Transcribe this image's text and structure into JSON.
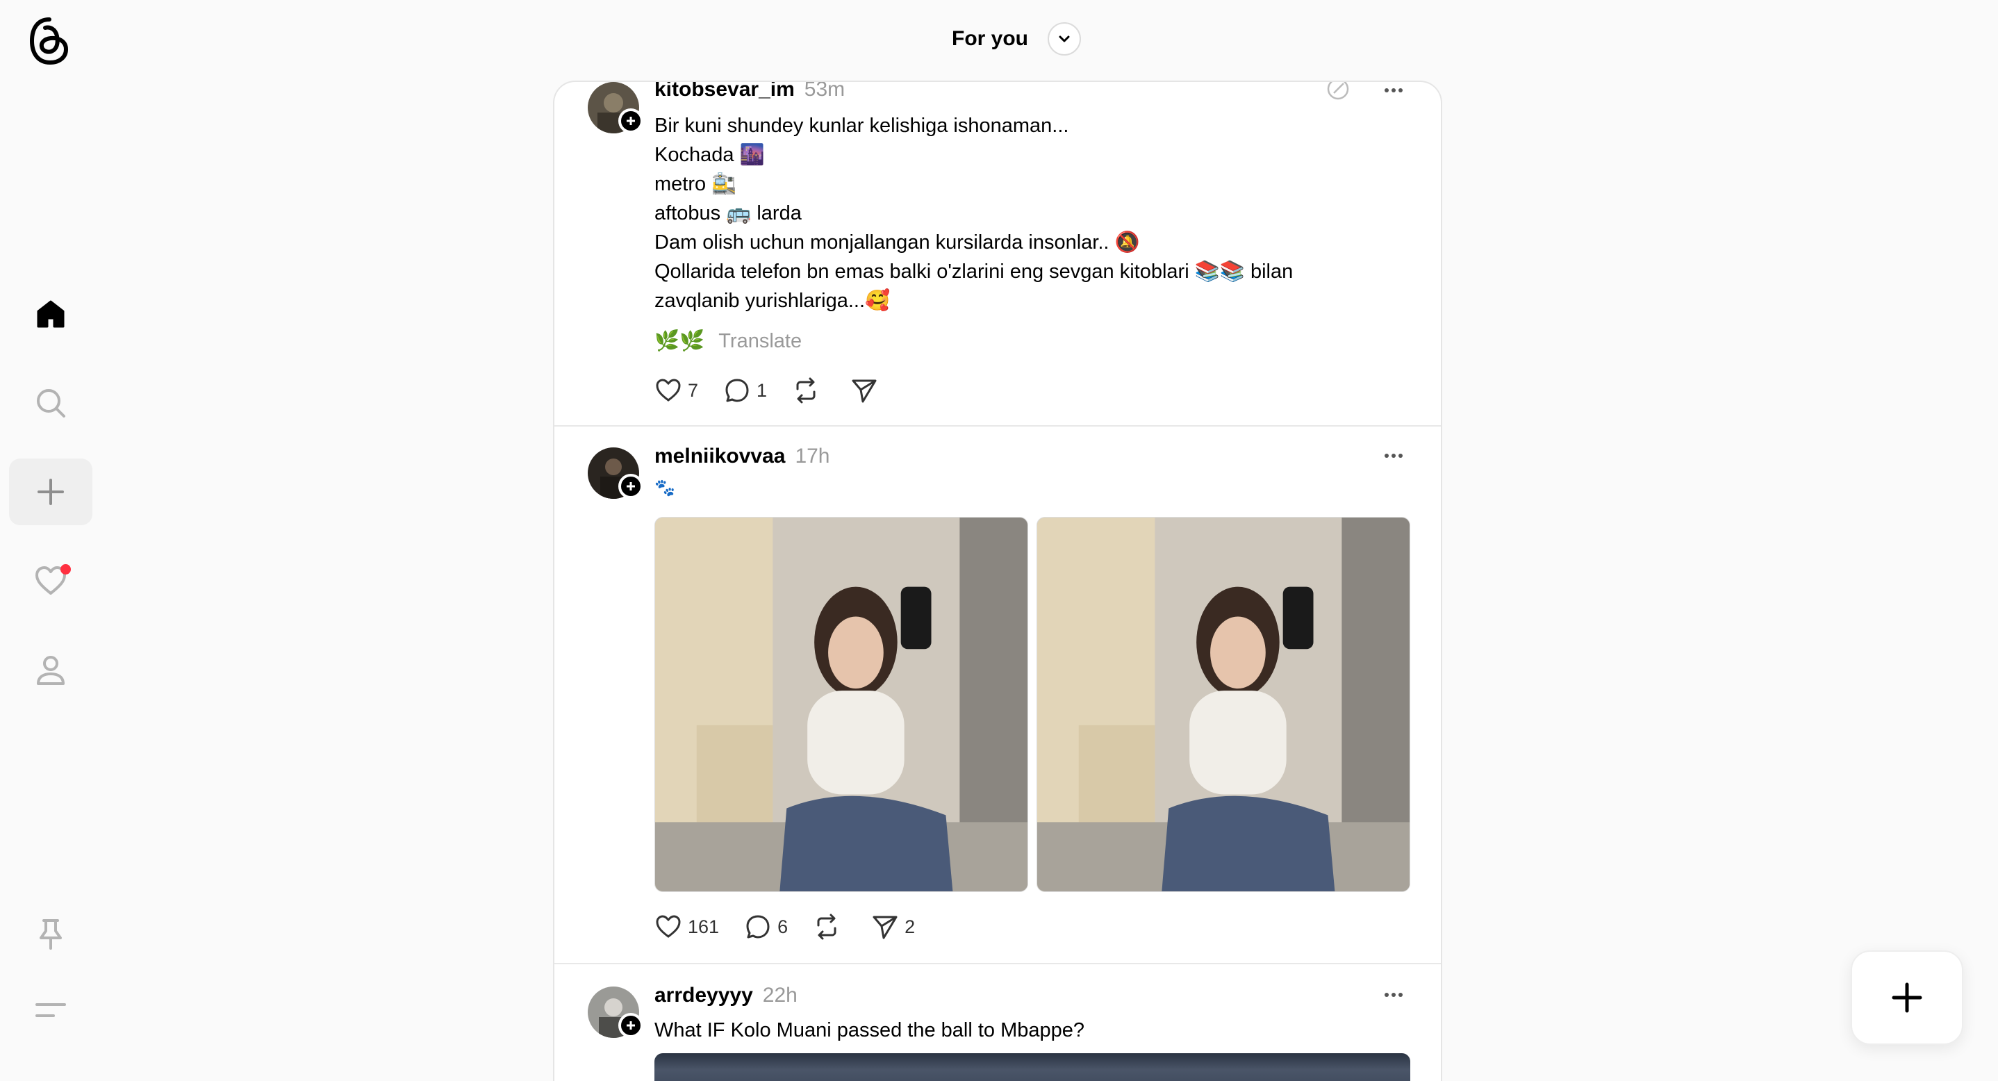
{
  "app": {
    "logo": "threads-logo-icon"
  },
  "header": {
    "feed_title": "For you",
    "toggle_icon": "chevron-down-icon"
  },
  "sidebar": {
    "items": [
      {
        "name": "home",
        "icon": "home-icon",
        "active": true
      },
      {
        "name": "search",
        "icon": "search-icon"
      },
      {
        "name": "create",
        "icon": "plus-icon"
      },
      {
        "name": "activity",
        "icon": "heart-icon",
        "has_notification": true
      },
      {
        "name": "profile",
        "icon": "person-icon"
      },
      {
        "name": "pinned",
        "icon": "pin-icon"
      },
      {
        "name": "menu",
        "icon": "menu-icon"
      }
    ],
    "notification_color": "#ff3040"
  },
  "posts": [
    {
      "username": "kitobsevar_im",
      "time": "53m",
      "text": "Bir kuni shundey kunlar kelishiga ishonaman...\nKochada 🌆\nmetro 🚉\naftobus 🚌 larda\nDam olish uchun monjallangan kursilarda insonlar.. 🔕\nQollarida telefon bn emas balki o'zlarini eng sevgan kitoblari 📚📚 bilan\nzavqlanib yurishlariga...🥰",
      "extra": "🌿🌿",
      "translate_label": "Translate",
      "likes": "7",
      "replies": "1",
      "reposts": "",
      "shares": ""
    },
    {
      "username": "melniikovvaa",
      "time": "17h",
      "text": "🐾",
      "likes": "161",
      "replies": "6",
      "reposts": "",
      "shares": "2",
      "photo_count": 2
    },
    {
      "username": "arrdeyyyy",
      "time": "22h",
      "text": "What IF Kolo Muani passed the ball to Mbappe?"
    }
  ],
  "fab": {
    "icon": "plus-icon"
  }
}
